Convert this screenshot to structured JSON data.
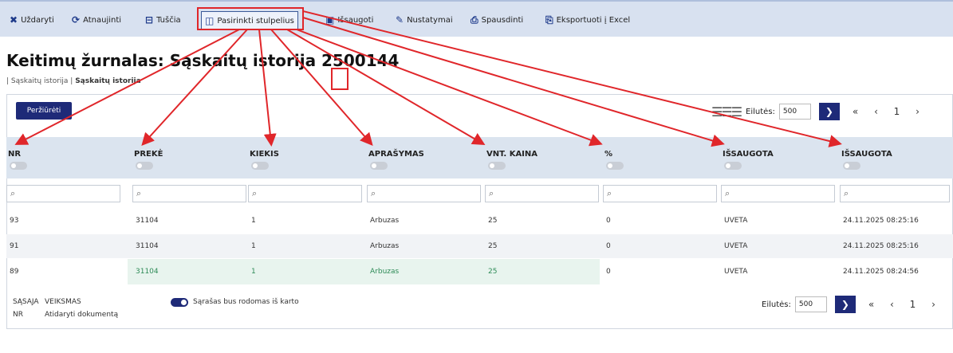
{
  "toolbar": {
    "items": [
      {
        "icon": "close-icon",
        "glyph": "✖",
        "label": "Uždaryti"
      },
      {
        "icon": "refresh-icon",
        "glyph": "⟳",
        "label": "Atnaujinti"
      },
      {
        "icon": "clear-icon",
        "glyph": "⊟",
        "label": "Tuščia"
      },
      {
        "icon": "columns-icon",
        "glyph": "◫",
        "label": "Pasirinkti stulpelius"
      },
      {
        "icon": "save-icon",
        "glyph": "▣",
        "label": "Išsaugoti"
      },
      {
        "icon": "wrench-icon",
        "glyph": "✎",
        "label": "Nustatymai"
      },
      {
        "icon": "print-icon",
        "glyph": "⎙",
        "label": "Spausdinti"
      },
      {
        "icon": "export-icon",
        "glyph": "⎘",
        "label": "Eksportuoti į Excel"
      }
    ]
  },
  "page": {
    "title": "Keitimų žurnalas: Sąskaitų istorija 2500144",
    "breadcrumb_1": "| Sąskaitų istorija |",
    "breadcrumb_2": "Sąskaitų istorija",
    "view_button": "Peržiūrėti"
  },
  "pager": {
    "rows_label": "Eilutės:",
    "rows_value": "500",
    "go": "❯",
    "nav": "« ‹ 1 ›"
  },
  "columns": [
    "NR",
    "PREKĖ",
    "KIEKIS",
    "APRAŠYMAS",
    "VNT. KAINA",
    "%",
    "IŠSAUGOTA",
    "IŠSAUGOTA"
  ],
  "filter_icon": "search-icon",
  "filter_glyph": "⌕",
  "rows": [
    [
      "93",
      "31104",
      "1",
      "Arbuzas",
      "25",
      "0",
      "UVETA",
      "24.11.2025 08:25:16"
    ],
    [
      "91",
      "31104",
      "1",
      "Arbuzas",
      "25",
      "0",
      "UVETA",
      "24.11.2025 08:25:16"
    ],
    [
      "89",
      "31104",
      "1",
      "Arbuzas",
      "25",
      "0",
      "UVETA",
      "24.11.2025 08:24:56"
    ]
  ],
  "footer": {
    "sasaja": "SĄSAJA",
    "veiksmas": "VEIKSMAS",
    "nr": "NR",
    "open_doc": "Atidaryti dokumentą",
    "list_toggle_label": "Sąrašas bus rodomas iš karto"
  },
  "colors": {
    "accent": "#1e2a78",
    "annotation": "#e0262a",
    "header_band": "#dbe4ef"
  }
}
